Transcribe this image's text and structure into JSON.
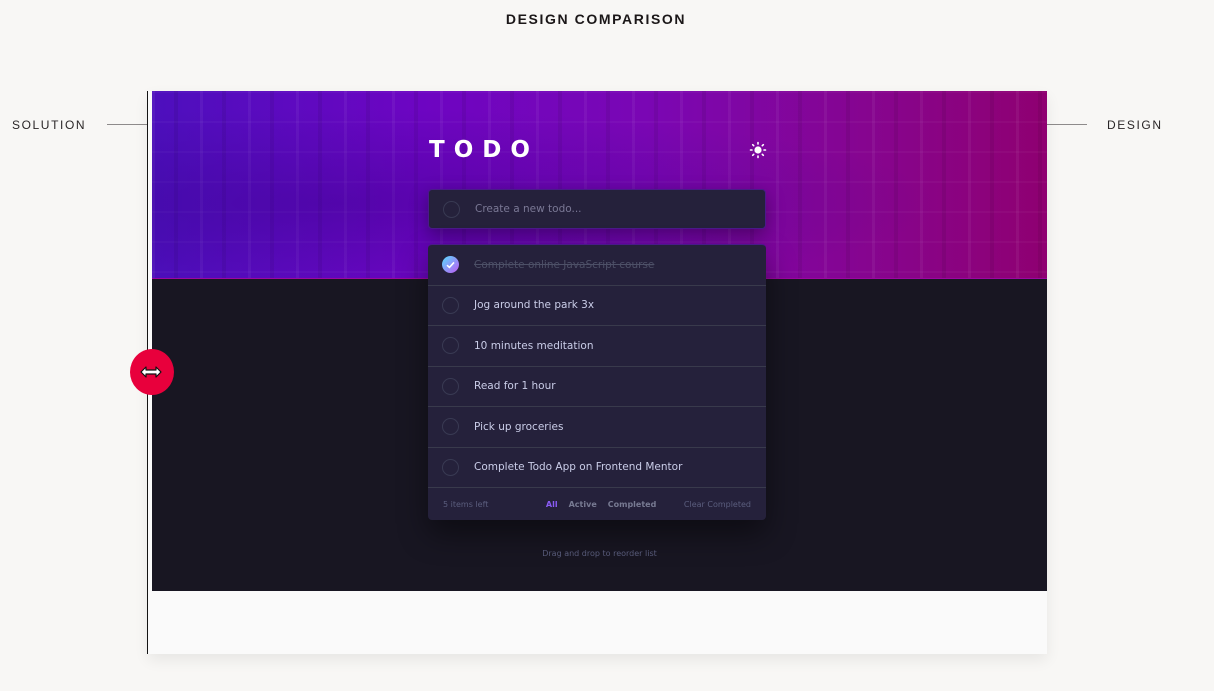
{
  "header": {
    "title": "DESIGN COMPARISON"
  },
  "labels": {
    "solution": "SOLUTION",
    "design": "DESIGN"
  },
  "app": {
    "logo": "TODO",
    "theme_icon": "sun-icon",
    "new_todo": {
      "placeholder": "Create a new todo..."
    },
    "todos": [
      {
        "text": "Complete online JavaScript course",
        "completed": true
      },
      {
        "text": "Jog around the park 3x",
        "completed": false
      },
      {
        "text": "10 minutes meditation",
        "completed": false
      },
      {
        "text": "Read for 1 hour",
        "completed": false
      },
      {
        "text": "Pick up groceries",
        "completed": false
      },
      {
        "text": "Complete Todo App on Frontend Mentor",
        "completed": false
      }
    ],
    "footer": {
      "items_left": "5 items left",
      "filters": [
        "All",
        "Active",
        "Completed"
      ],
      "active_filter": "All",
      "clear": "Clear Completed"
    },
    "hint": "Drag and drop to reorder list"
  },
  "colors": {
    "accent": "#e8003c",
    "check_gradient_start": "#57ddff",
    "check_gradient_end": "#c058f3",
    "active_filter": "#8a5cf5"
  },
  "slider": {
    "icon": "resize-arrows-icon"
  }
}
